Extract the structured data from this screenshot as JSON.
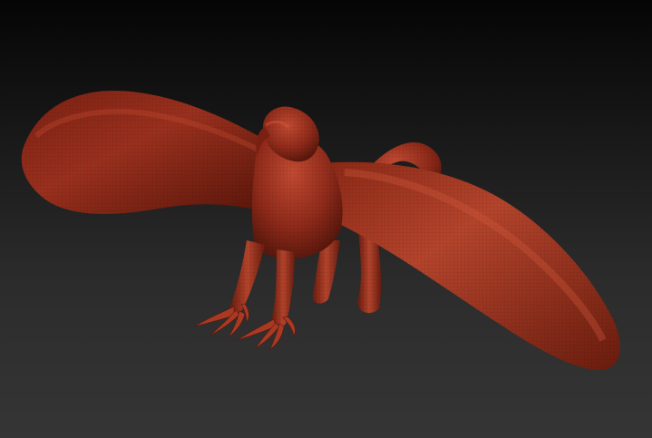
{
  "scene": {
    "subject": "griffin-sculpt",
    "colors": {
      "background_top": "#050505",
      "background_bottom": "#353535",
      "model_base": "#8e2a1a",
      "model_highlight": "#c24a32",
      "model_shadow": "#4a1208"
    }
  }
}
